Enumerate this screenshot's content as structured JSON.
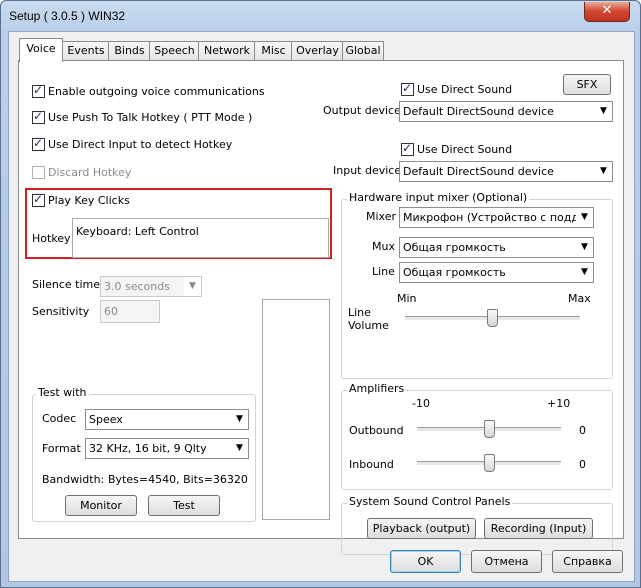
{
  "window": {
    "title": "Setup ( 3.0.5 ) WIN32",
    "close": "✕"
  },
  "tabs": [
    "Voice",
    "Events",
    "Binds",
    "Speech",
    "Network",
    "Misc",
    "Overlay",
    "Global"
  ],
  "voice": {
    "enable_outgoing": "Enable outgoing voice communications",
    "use_ptt": "Use Push To Talk Hotkey ( PTT Mode )",
    "direct_input": "Use Direct Input to detect Hotkey",
    "discard_hotkey": "Discard Hotkey",
    "play_key_clicks": "Play Key Clicks",
    "hotkey_label": "Hotkey",
    "hotkey_value": "Keyboard: Left Control",
    "silence_label": "Silence time",
    "silence_value": "3.0 seconds",
    "sensitivity_label": "Sensitivity",
    "sensitivity_value": "60"
  },
  "output": {
    "use_direct_sound": "Use Direct Sound",
    "sfx_button": "SFX",
    "device_label": "Output device",
    "device_value": "Default DirectSound device"
  },
  "input": {
    "use_direct_sound": "Use Direct Sound",
    "device_label": "Input device",
    "device_value": "Default DirectSound device"
  },
  "mixer": {
    "title": "Hardware input mixer (Optional)",
    "mixer_label": "Mixer",
    "mixer_value": "Микрофон (Устройство с поддерж",
    "mux_label": "Mux",
    "mux_value": "Общая громкость",
    "line_label": "Line",
    "line_value": "Общая громкость",
    "min_label": "Min",
    "max_label": "Max",
    "line_volume_label_1": "Line",
    "line_volume_label_2": "Volume",
    "line_volume_level": 0.5
  },
  "amplifiers": {
    "title": "Amplifiers",
    "min_label": "-10",
    "max_label": "+10",
    "outbound_label": "Outbound",
    "outbound_value": "0",
    "inbound_label": "Inbound",
    "inbound_value": "0"
  },
  "test": {
    "title": "Test with",
    "codec_label": "Codec",
    "codec_value": "Speex",
    "format_label": "Format",
    "format_value": "32 KHz, 16 bit, 9 Qlty",
    "bandwidth_label": "Bandwidth:",
    "bandwidth_value": "Bytes=4540, Bits=36320",
    "monitor_button": "Monitor",
    "test_button": "Test"
  },
  "sound_panels": {
    "title": "System Sound Control Panels",
    "playback_button": "Playback (output)",
    "recording_button": "Recording (Input)"
  },
  "footer": {
    "ok": "OK",
    "cancel": "Отмена",
    "help": "Справка"
  },
  "colors": {
    "highlight": "#d32020",
    "check": "#1d2c6b"
  }
}
